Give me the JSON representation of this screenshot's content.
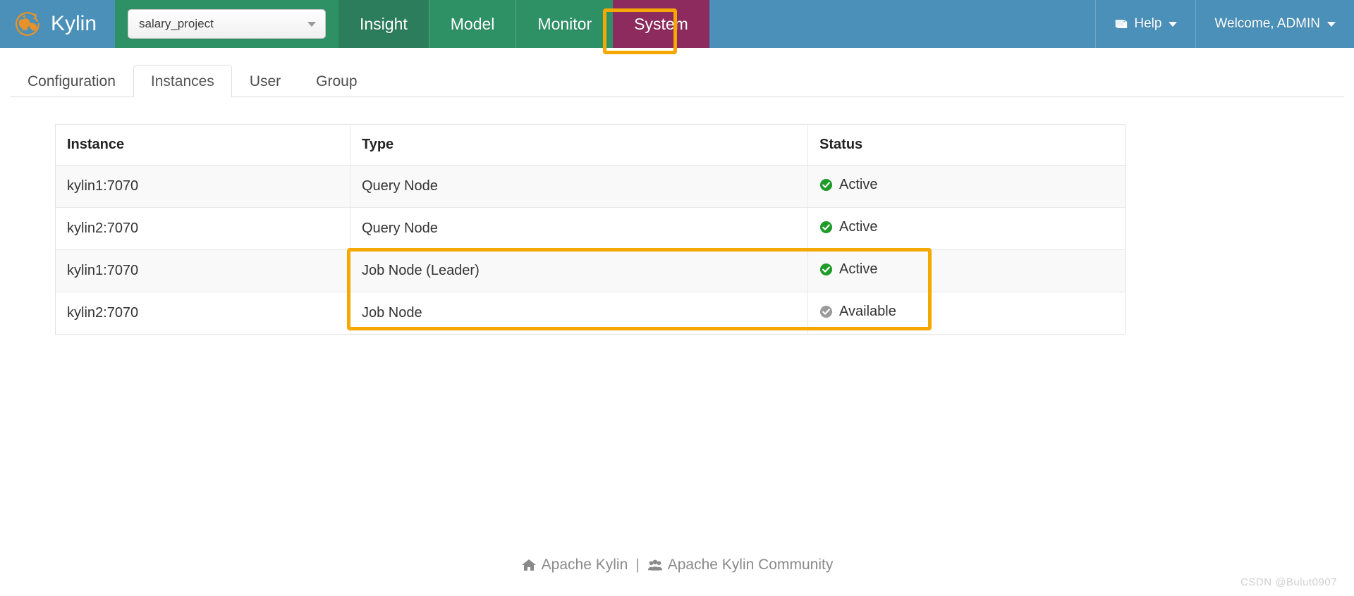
{
  "app": {
    "brand_name": "Kylin",
    "logo_icon": "kylin-logo-icon"
  },
  "project_selector": {
    "value": "salary_project",
    "placeholder": "salary_project",
    "caret_icon": "caret-down-icon"
  },
  "nav": {
    "items": [
      {
        "label": "Insight",
        "state": "hover"
      },
      {
        "label": "Model",
        "state": "default"
      },
      {
        "label": "Monitor",
        "state": "default"
      },
      {
        "label": "System",
        "state": "current"
      }
    ]
  },
  "nav_right": {
    "help": {
      "label": "Help",
      "icon": "book-icon",
      "caret_icon": "caret-down-icon"
    },
    "user": {
      "label": "Welcome, ADMIN",
      "caret_icon": "caret-down-icon"
    }
  },
  "subtabs": {
    "items": [
      {
        "label": "Configuration",
        "active": false
      },
      {
        "label": "Instances",
        "active": true
      },
      {
        "label": "User",
        "active": false
      },
      {
        "label": "Group",
        "active": false
      }
    ]
  },
  "table": {
    "columns": [
      "Instance",
      "Type",
      "Status"
    ],
    "rows": [
      {
        "instance": "kylin1:7070",
        "type": "Query Node",
        "status": "Active",
        "status_icon": "check-circle-green-icon"
      },
      {
        "instance": "kylin2:7070",
        "type": "Query Node",
        "status": "Active",
        "status_icon": "check-circle-green-icon"
      },
      {
        "instance": "kylin1:7070",
        "type": "Job Node (Leader)",
        "status": "Active",
        "status_icon": "check-circle-green-icon"
      },
      {
        "instance": "kylin2:7070",
        "type": "Job Node",
        "status": "Available",
        "status_icon": "check-circle-gray-icon"
      }
    ]
  },
  "footer": {
    "home_icon": "home-icon",
    "link_1": "Apache Kylin",
    "separator": "|",
    "community_icon": "users-icon",
    "link_2": "Apache Kylin Community"
  },
  "watermark": {
    "text": "CSDN @Bulut0907"
  },
  "annotations": {
    "system_tab_highlight": "orange-highlight-box",
    "job-node-rows-highlight": "orange-highlight-box"
  },
  "colors": {
    "header_blue": "#4A90B8",
    "nav_green": "#2E9166",
    "nav_green_dark": "#2B7D5C",
    "system_maroon": "#8E2B5E",
    "highlight_orange": "#F5A800",
    "status_active_green": "#1E9B28",
    "status_available_gray": "#9B9B9B",
    "logo_orange": "#E8922A"
  }
}
